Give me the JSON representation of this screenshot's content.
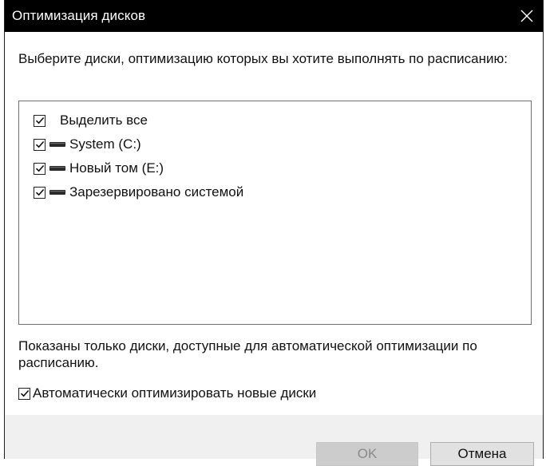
{
  "window": {
    "title": "Оптимизация дисков",
    "close_icon": "close-icon"
  },
  "prompt": "Выберите диски, оптимизацию которых вы хотите выполнять по расписанию:",
  "drive_list": {
    "select_all": {
      "label": "Выделить все",
      "checked": true
    },
    "items": [
      {
        "label": "System (C:)",
        "checked": true,
        "icon": "drive-icon"
      },
      {
        "label": "Новый том (E:)",
        "checked": true,
        "icon": "drive-icon"
      },
      {
        "label": "Зарезервировано системой",
        "checked": true,
        "icon": "drive-icon"
      }
    ]
  },
  "note": "Показаны только диски, доступные для автоматической оптимизации по расписанию.",
  "auto_optimize": {
    "label": "Автоматически оптимизировать новые диски",
    "checked": true
  },
  "buttons": {
    "ok_label": "OK",
    "ok_disabled": true,
    "cancel_label": "Отмена"
  },
  "colors": {
    "titlebar": "#000000",
    "footer": "#f0f0f0",
    "ok_disabled_bg": "#cccccc"
  }
}
